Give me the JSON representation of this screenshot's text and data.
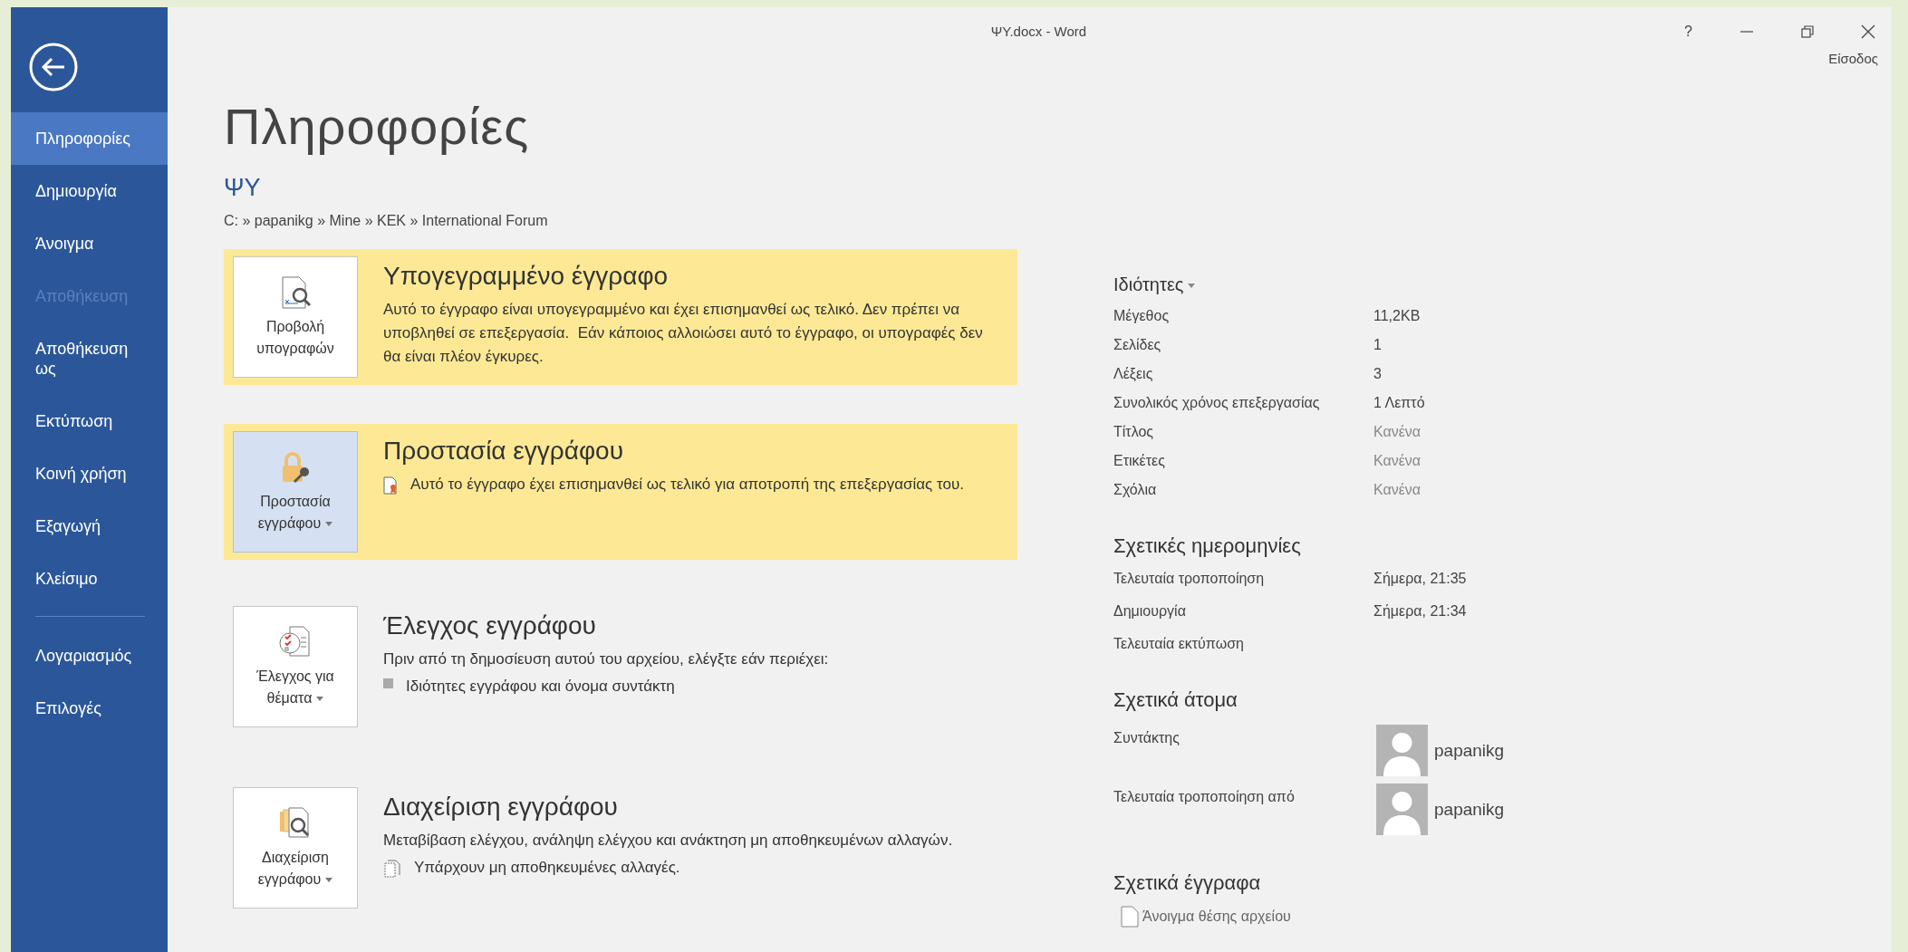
{
  "window": {
    "title": "ΨY.docx - Word",
    "help": "?",
    "account": "Είσοδος"
  },
  "sidebar": {
    "items": [
      {
        "label": "Πληροφορίες",
        "selected": true,
        "disabled": false
      },
      {
        "label": "Δημιουργία",
        "selected": false,
        "disabled": false
      },
      {
        "label": "Άνοιγμα",
        "selected": false,
        "disabled": false
      },
      {
        "label": "Αποθήκευση",
        "selected": false,
        "disabled": true
      },
      {
        "label": "Αποθήκευση ως",
        "selected": false,
        "disabled": false
      },
      {
        "label": "Εκτύπωση",
        "selected": false,
        "disabled": false
      },
      {
        "label": "Κοινή χρήση",
        "selected": false,
        "disabled": false
      },
      {
        "label": "Εξαγωγή",
        "selected": false,
        "disabled": false
      },
      {
        "label": "Κλείσιμο",
        "selected": false,
        "disabled": false
      }
    ],
    "bottom_items": [
      {
        "label": "Λογαριασμός",
        "selected": false,
        "disabled": false
      },
      {
        "label": "Επιλογές",
        "selected": false,
        "disabled": false
      }
    ]
  },
  "page": {
    "heading": "Πληροφορίες",
    "doc_name": "ΨΥ",
    "path": "C: » papanikg » Mine » KEK » International Forum"
  },
  "sections": [
    {
      "kind": "signature",
      "highlighted": true,
      "button": {
        "label": "Προβολή υπογραφών",
        "dropdown": false,
        "pressed": false
      },
      "title": "Υπογεγραμμένο έγγραφο",
      "description": "Αυτό το έγγραφο είναι υπογεγραμμένο και έχει επισημανθεί ως τελικό. Δεν πρέπει να υποβληθεί σε επεξεργασία.  Εάν κάποιος αλλοιώσει αυτό το έγγραφο, οι υπογραφές δεν θα είναι πλέον έγκυρες."
    },
    {
      "kind": "lock",
      "highlighted": true,
      "button": {
        "label": "Προστασία εγγράφου",
        "dropdown": true,
        "pressed": true
      },
      "title": "Προστασία εγγράφου",
      "notes": [
        {
          "kind": "seal",
          "text": "Αυτό το έγγραφο έχει επισημανθεί ως τελικό για αποτροπή της επεξεργασίας του."
        }
      ]
    },
    {
      "kind": "inspect",
      "highlighted": false,
      "button": {
        "label": "Έλεγχος για θέματα",
        "dropdown": true,
        "pressed": false
      },
      "title": "Έλεγχος εγγράφου",
      "description": "Πριν από τη δημοσίευση αυτού του αρχείου, ελέγξτε εάν περιέχει:",
      "notes": [
        {
          "kind": "bullet",
          "text": "Ιδιότητες εγγράφου και όνομα συντάκτη"
        }
      ]
    },
    {
      "kind": "manage",
      "highlighted": false,
      "button": {
        "label": "Διαχείριση εγγράφου",
        "dropdown": true,
        "pressed": false
      },
      "title": "Διαχείριση εγγράφου",
      "description": "Μεταβίβαση ελέγχου, ανάληψη ελέγχου και ανάκτηση μη αποθηκευμένων αλλαγών.",
      "notes": [
        {
          "kind": "unsaved",
          "text": "Υπάρχουν μη αποθηκευμένες αλλαγές."
        }
      ]
    }
  ],
  "properties": {
    "heading": "Ιδιότητες",
    "rows": [
      {
        "label": "Μέγεθος",
        "value": "11,2KB",
        "muted": false
      },
      {
        "label": "Σελίδες",
        "value": "1",
        "muted": false
      },
      {
        "label": "Λέξεις",
        "value": "3",
        "muted": false
      },
      {
        "label": "Συνολικός χρόνος επεξεργασίας",
        "value": "1 Λεπτό",
        "muted": false
      },
      {
        "label": "Τίτλος",
        "value": "Κανένα",
        "muted": true
      },
      {
        "label": "Ετικέτες",
        "value": "Κανένα",
        "muted": true
      },
      {
        "label": "Σχόλια",
        "value": "Κανένα",
        "muted": true
      }
    ]
  },
  "dates": {
    "heading": "Σχετικές ημερομηνίες",
    "rows": [
      {
        "label": "Τελευταία τροποποίηση",
        "value": "Σήμερα, 21:35"
      },
      {
        "label": "Δημιουργία",
        "value": "Σήμερα, 21:34"
      },
      {
        "label": "Τελευταία εκτύπωση"
      }
    ]
  },
  "people": {
    "heading": "Σχετικά άτομα",
    "rows": [
      {
        "label": "Συντάκτης",
        "name": "papanikg"
      },
      {
        "label": "Τελευταία τροποποίηση από",
        "name": "papanikg"
      }
    ]
  },
  "related": {
    "heading": "Σχετικά έγγραφα",
    "links": [
      "Άνοιγμα θέσης αρχείου"
    ]
  }
}
